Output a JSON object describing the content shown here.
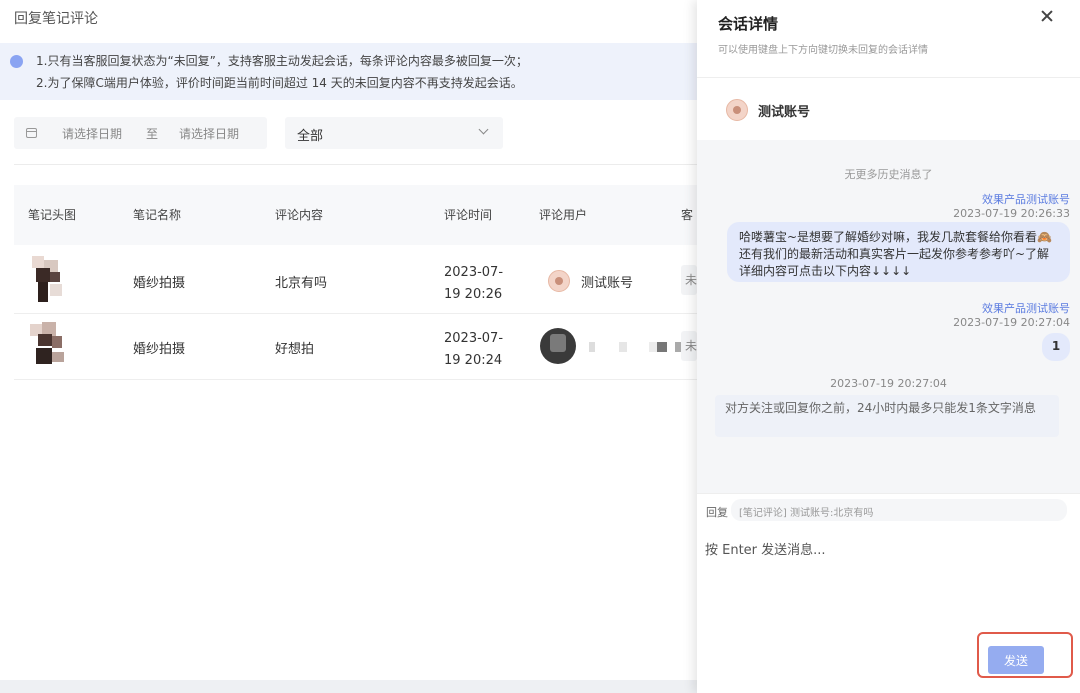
{
  "page": {
    "title": "回复笔记评论",
    "notice": [
      "1.只有当客服回复状态为“未回复”，支持客服主动发起会话，每条评论内容最多被回复一次；",
      "2.为了保障C端用户体验，评价时间距当前时间超过 14 天的未回复内容不再支持发起会话。"
    ]
  },
  "filters": {
    "date_start_placeholder": "请选择日期",
    "date_separator": "至",
    "date_end_placeholder": "请选择日期",
    "status_selected": "全部"
  },
  "table": {
    "columns": [
      "笔记头图",
      "笔记名称",
      "评论内容",
      "评论时间",
      "评论用户",
      "客"
    ],
    "rows": [
      {
        "note_name": "婚纱拍摄",
        "comment": "北京有吗",
        "time_line1": "2023-07-",
        "time_line2": "19 20:26",
        "user": "测试账号",
        "status_stub": "未"
      },
      {
        "note_name": "婚纱拍摄",
        "comment": "好想拍",
        "time_line1": "2023-07-",
        "time_line2": "19 20:24",
        "user": "",
        "status_stub": "未"
      }
    ]
  },
  "drawer": {
    "title": "会话详情",
    "subtitle": "可以使用键盘上下方向键切换未回复的会话详情",
    "account_name": "测试账号",
    "no_more_history": "无更多历史消息了",
    "messages": [
      {
        "sender": "效果产品测试账号",
        "time": "2023-07-19 20:26:33",
        "text": "哈喽薯宝~是想要了解婚纱对嘛，我发几款套餐给你看看🙈还有我们的最新活动和真实客片一起发你参考参考吖~了解详细内容可点击以下内容↓↓↓↓"
      },
      {
        "sender": "效果产品测试账号",
        "time": "2023-07-19 20:27:04",
        "text": "1"
      }
    ],
    "system_time": "2023-07-19 20:27:04",
    "system_message": "对方关注或回复你之前，24小时内最多只能发1条文字消息",
    "reply_label": "回复",
    "reply_quote": "[笔记评论] 测试账号:北京有吗",
    "input_placeholder": "按 Enter 发送消息...",
    "send_label": "发送"
  },
  "colors": {
    "accent": "#95acf0",
    "notice_bg": "#eef2fb",
    "highlight_border": "#e05a4a",
    "sender_blue": "#5a7be0"
  }
}
